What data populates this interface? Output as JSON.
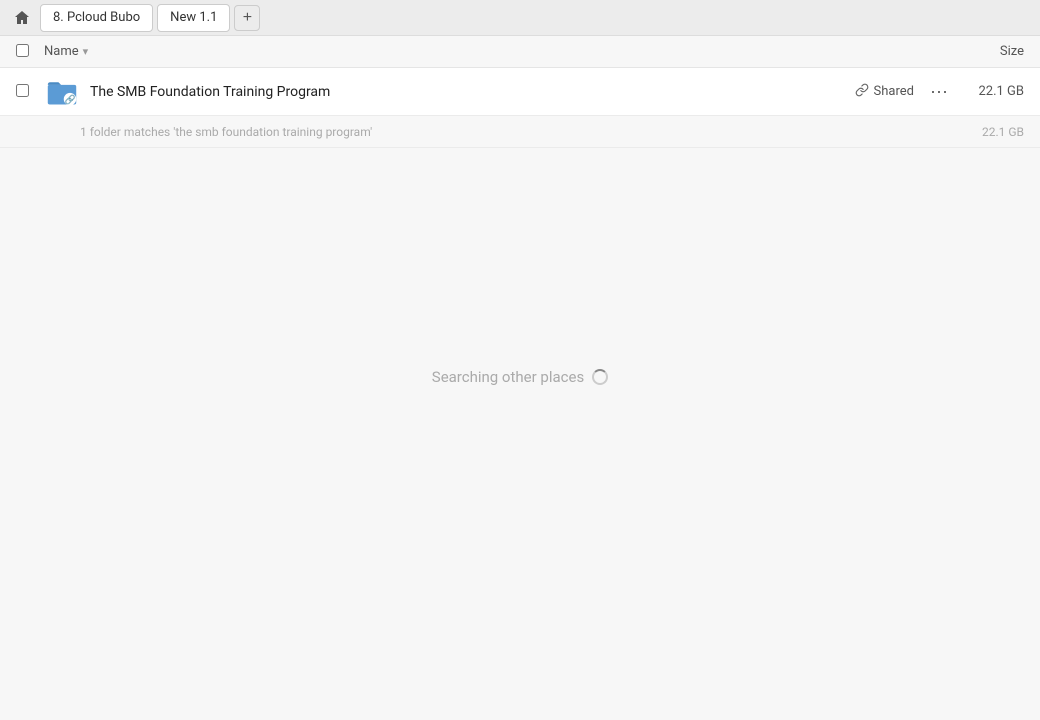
{
  "topbar": {
    "home_icon": "🏠",
    "tabs": [
      {
        "label": "8. Pcloud Bubo",
        "closable": false
      },
      {
        "label": "New 1.1",
        "closable": false
      }
    ],
    "add_tab_label": "+"
  },
  "columns": {
    "checkbox_label": "",
    "name_label": "Name",
    "sort_icon": "▾",
    "size_label": "Size"
  },
  "file_row": {
    "name": "The SMB Foundation Training Program",
    "shared_label": "Shared",
    "size": "22.1 GB",
    "more_dots": "···"
  },
  "match_row": {
    "text": "1 folder matches 'the smb foundation training program'",
    "size": "22.1 GB"
  },
  "searching": {
    "text": "Searching other places"
  }
}
